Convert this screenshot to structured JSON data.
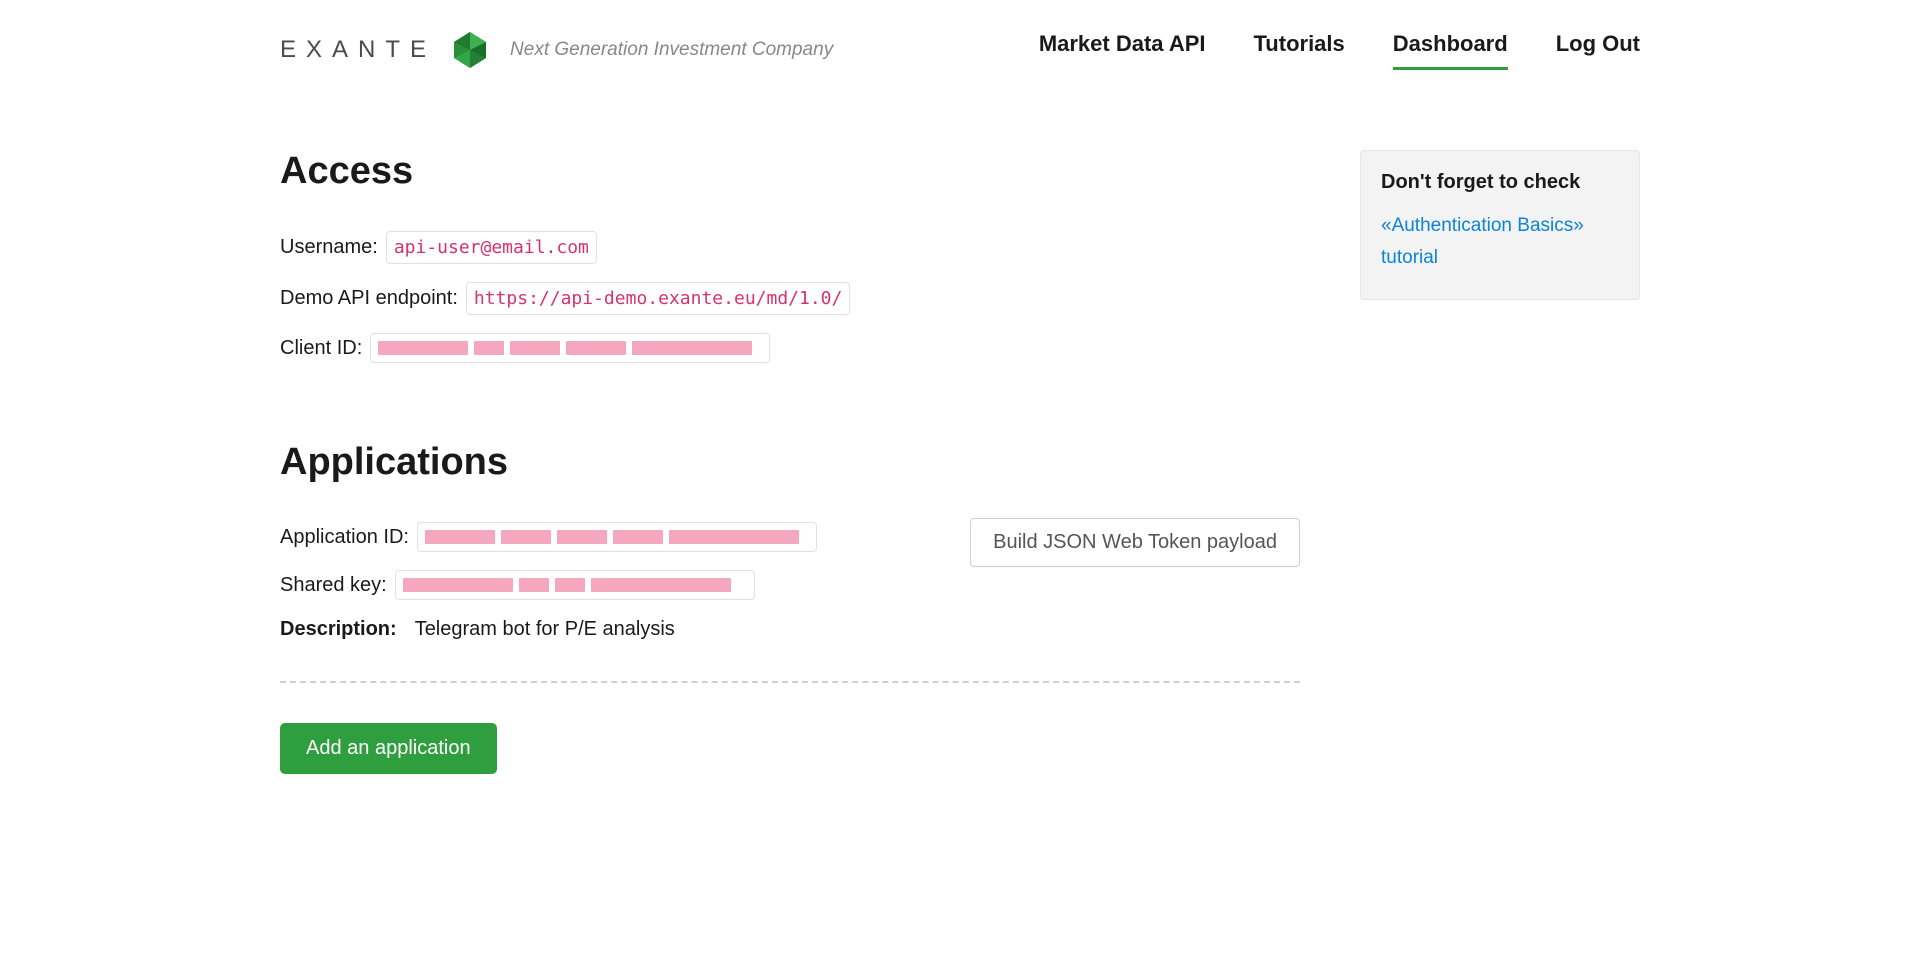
{
  "brand": {
    "name": "EXANTE",
    "tagline": "Next Generation Investment Company"
  },
  "nav": {
    "items": [
      {
        "label": "Market Data API",
        "active": false
      },
      {
        "label": "Tutorials",
        "active": false
      },
      {
        "label": "Dashboard",
        "active": true
      },
      {
        "label": "Log Out",
        "active": false
      }
    ]
  },
  "sections": {
    "access_title": "Access",
    "applications_title": "Applications"
  },
  "access": {
    "username_label": "Username:",
    "username_value": "api-user@email.com",
    "endpoint_label": "Demo API endpoint:",
    "endpoint_value": "https://api-demo.exante.eu/md/1.0/",
    "client_id_label": "Client ID:",
    "client_id_value_redacted": true
  },
  "application": {
    "id_label": "Application ID:",
    "id_value_redacted": true,
    "key_label": "Shared key:",
    "key_value_redacted": true,
    "description_label": "Description:",
    "description_value": "Telegram bot for P/E analysis",
    "build_token_label": "Build JSON Web Token payload"
  },
  "actions": {
    "add_application_label": "Add an application"
  },
  "aside": {
    "title": "Don't forget to check",
    "link_text": "«Authentication Basics» tutorial"
  }
}
